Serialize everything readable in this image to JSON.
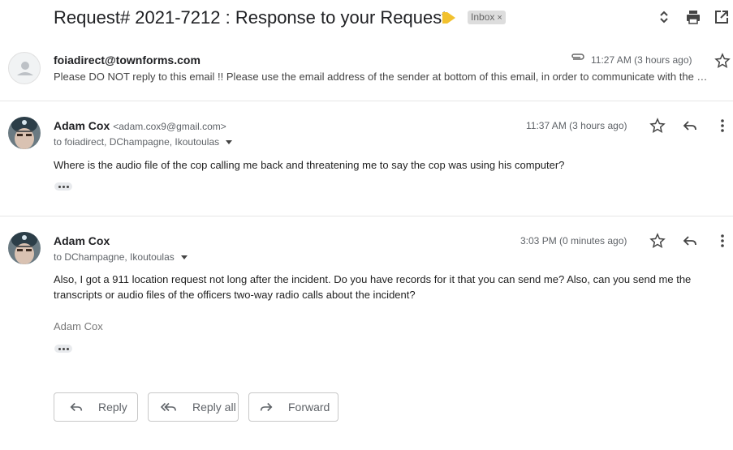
{
  "thread": {
    "subject": "Request# 2021-7212 : Response to your Request",
    "label": "Inbox",
    "label_remove": "×"
  },
  "messages": [
    {
      "sender": "foiadirect@townforms.com",
      "time": "11:27 AM (3 hours ago)",
      "snippet": "Please DO NOT reply to this email !! Please use the email address of the sender at bottom of this email, in order to communicate with the …",
      "has_attachment": true,
      "collapsed": true
    },
    {
      "sender": "Adam Cox",
      "sender_email": "<adam.cox9@gmail.com>",
      "recipients": "to foiadirect, DChampagne, Ikoutoulas",
      "time": "11:37 AM (3 hours ago)",
      "body": "Where is the audio file of the cop calling me back and threatening me to say the cop was using his computer?"
    },
    {
      "sender": "Adam Cox",
      "recipients": "to DChampagne, Ikoutoulas",
      "time": "3:03 PM (0 minutes ago)",
      "body": "Also, I got a 911 location request not long after the incident. Do you have records for it that you can send me? Also, can you send me the transcripts or audio files of the officers two-way radio calls about the incident?",
      "signature": "Adam Cox"
    }
  ],
  "actions": {
    "reply": "Reply",
    "reply_all": "Reply all",
    "forward": "Forward"
  },
  "colors": {
    "important_marker": "#f2c12e",
    "label_bg": "#dddddd",
    "divider": "#e6e6e6",
    "icon": "#5f6368"
  }
}
